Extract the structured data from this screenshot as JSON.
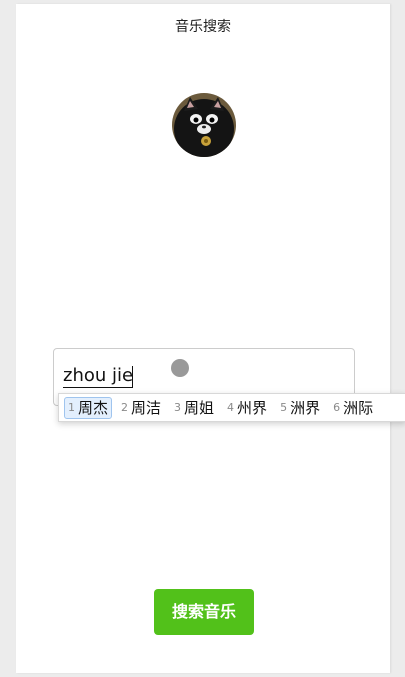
{
  "header": {
    "title": "音乐搜索"
  },
  "search": {
    "input_value": "zhou jie"
  },
  "ime": {
    "candidates": [
      {
        "num": "1",
        "text": "周杰"
      },
      {
        "num": "2",
        "text": "周洁"
      },
      {
        "num": "3",
        "text": "周姐"
      },
      {
        "num": "4",
        "text": "州界"
      },
      {
        "num": "5",
        "text": "洲界"
      },
      {
        "num": "6",
        "text": "洲际"
      }
    ]
  },
  "actions": {
    "search_button": "搜索音乐"
  },
  "colors": {
    "button": "#52c11a",
    "selected_candidate": "#e3effd"
  }
}
